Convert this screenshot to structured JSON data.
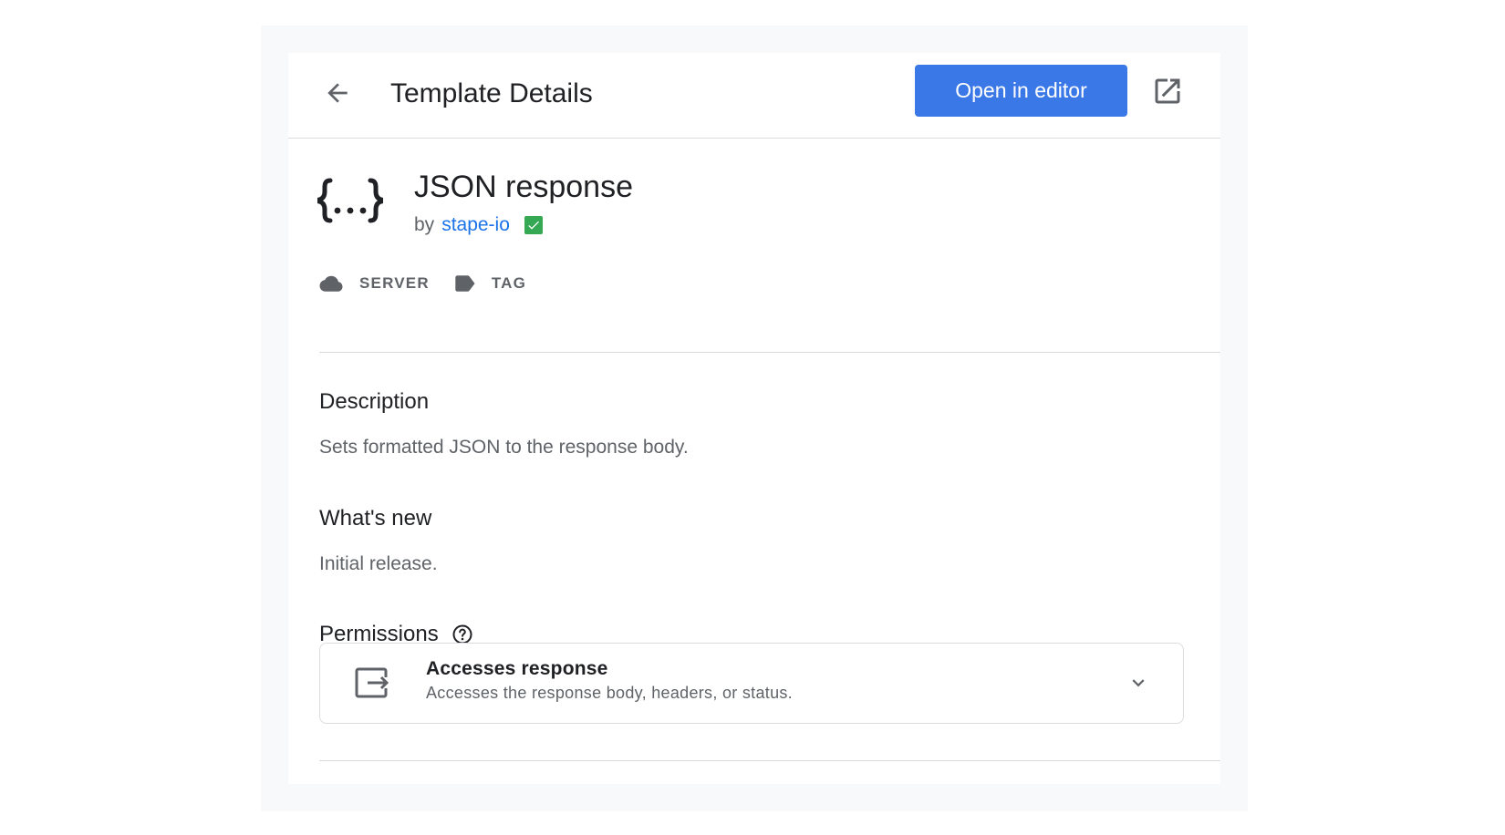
{
  "header": {
    "title": "Template Details",
    "open_button": "Open in editor",
    "back_icon": "arrow-back-icon",
    "external_icon": "open-in-new-icon"
  },
  "template": {
    "icon": "curly-braces-icon",
    "name": "JSON response",
    "by_label": "by",
    "author": "stape-io",
    "verified": true
  },
  "tags": [
    {
      "label": "SERVER",
      "icon": "cloud-icon"
    },
    {
      "label": "TAG",
      "icon": "label-icon"
    }
  ],
  "description": {
    "title": "Description",
    "text": "Sets formatted JSON to the response body."
  },
  "whats_new": {
    "title": "What's new",
    "text": "Initial release."
  },
  "permissions": {
    "title": "Permissions",
    "items": [
      {
        "icon": "exit-to-app-icon",
        "title": "Accesses response",
        "description": "Accesses the response body, headers, or status."
      }
    ]
  },
  "colors": {
    "primary": "#3b78e7",
    "link": "#1a73e8",
    "verified": "#34a853",
    "text": "#202124",
    "secondary_text": "#5f6368",
    "divider": "#dadce0",
    "frame": "#f8f9fa"
  }
}
